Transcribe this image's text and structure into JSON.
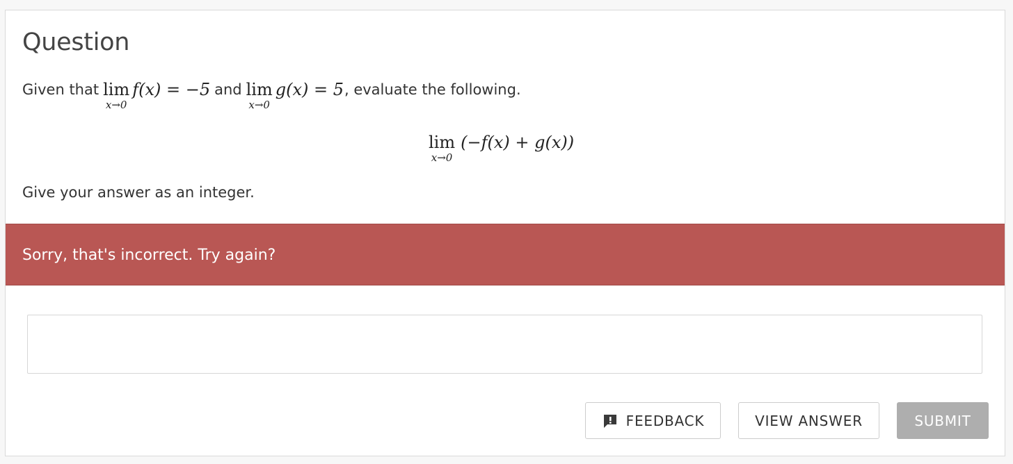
{
  "question": {
    "title": "Question",
    "prompt_prefix": "Given that",
    "limit1": {
      "operator": "lim",
      "subscript": "x→0",
      "expression": "f(x) = −5"
    },
    "conjunction": "and",
    "limit2": {
      "operator": "lim",
      "subscript": "x→0",
      "expression": "g(x) = 5"
    },
    "prompt_suffix": ", evaluate the following.",
    "display_limit": {
      "operator": "lim",
      "subscript": "x→0",
      "expression": "(−f(x) + g(x))"
    },
    "instruction": "Give your answer as an integer."
  },
  "alert": {
    "message": "Sorry, that's incorrect. Try again?",
    "color": "#b95754"
  },
  "answer": {
    "value": "",
    "placeholder": ""
  },
  "actions": {
    "feedback_label": "FEEDBACK",
    "feedback_icon": "feedback-icon",
    "view_answer_label": "VIEW ANSWER",
    "submit_label": "SUBMIT",
    "submit_color": "#aeaeae"
  }
}
